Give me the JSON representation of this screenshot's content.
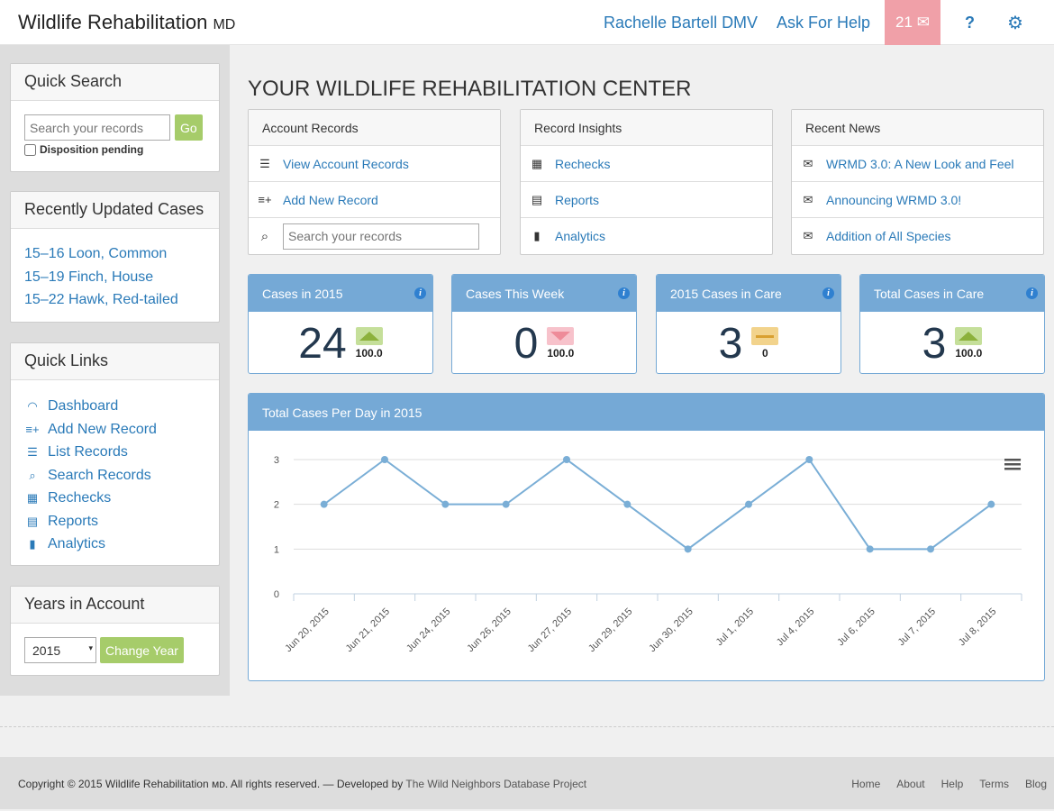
{
  "header": {
    "brand": "Wildlife Rehabilitation",
    "brand_suffix": "MD",
    "user": "Rachelle Bartell DMV",
    "help": "Ask For Help",
    "messages": "21",
    "help_icon": "?"
  },
  "sidebar": {
    "quick_search": {
      "title": "Quick Search",
      "placeholder": "Search your records",
      "go": "Go",
      "checkbox": "Disposition pending"
    },
    "recent": {
      "title": "Recently Updated Cases",
      "items": [
        "15–16 Loon, Common",
        "15–19 Finch, House",
        "15–22 Hawk, Red-tailed"
      ]
    },
    "links": {
      "title": "Quick Links",
      "items": [
        {
          "label": "Dashboard",
          "icon": "gauge-icon"
        },
        {
          "label": "Add New Record",
          "icon": "add-list-icon"
        },
        {
          "label": "List Records",
          "icon": "list-icon"
        },
        {
          "label": "Search Records",
          "icon": "search-icon"
        },
        {
          "label": "Rechecks",
          "icon": "calendar-icon"
        },
        {
          "label": "Reports",
          "icon": "report-icon"
        },
        {
          "label": "Analytics",
          "icon": "bar-chart-icon"
        }
      ]
    },
    "years": {
      "title": "Years in Account",
      "selected": "2015",
      "button": "Change Year"
    }
  },
  "main": {
    "title": "YOUR WILDLIFE REHABILITATION CENTER",
    "account": {
      "title": "Account Records",
      "view": "View Account Records",
      "add": "Add New Record",
      "placeholder": "Search your records"
    },
    "insights": {
      "title": "Record Insights",
      "items": [
        "Rechecks",
        "Reports",
        "Analytics"
      ]
    },
    "news": {
      "title": "Recent News",
      "items": [
        "WRMD 3.0: A New Look and Feel",
        "Announcing WRMD 3.0!",
        "Addition of All Species"
      ]
    },
    "stats": [
      {
        "title": "Cases in 2015",
        "value": "24",
        "change": "100.0",
        "trend": "up"
      },
      {
        "title": "Cases This Week",
        "value": "0",
        "change": "100.0",
        "trend": "down"
      },
      {
        "title": "2015 Cases in Care",
        "value": "3",
        "change": "0",
        "trend": "flat"
      },
      {
        "title": "Total Cases in Care",
        "value": "3",
        "change": "100.0",
        "trend": "up"
      }
    ],
    "colors": {
      "up": "#c5df9a",
      "down": "#f7c2cb",
      "flat": "#f2d38c",
      "accent": "#75a9d6",
      "series": "#7aaed6"
    }
  },
  "chart_data": {
    "type": "line",
    "title": "Total Cases Per Day in 2015",
    "categories": [
      "Jun 20, 2015",
      "Jun 21, 2015",
      "Jun 24, 2015",
      "Jun 26, 2015",
      "Jun 27, 2015",
      "Jun 29, 2015",
      "Jun 30, 2015",
      "Jul 1, 2015",
      "Jul 4, 2015",
      "Jul 6, 2015",
      "Jul 7, 2015",
      "Jul 8, 2015"
    ],
    "values": [
      2,
      3,
      2,
      2,
      3,
      2,
      1,
      2,
      3,
      1,
      1,
      2
    ],
    "ylim": [
      0,
      3
    ],
    "yticks": [
      0,
      1,
      2,
      3
    ],
    "grid": true
  },
  "footer": {
    "copyright": "Copyright © 2015 Wildlife Rehabilitation ᴍᴅ. All rights reserved. — Developed by",
    "project": "The Wild Neighbors Database Project",
    "links": [
      "Home",
      "About",
      "Help",
      "Terms",
      "Blog"
    ]
  }
}
